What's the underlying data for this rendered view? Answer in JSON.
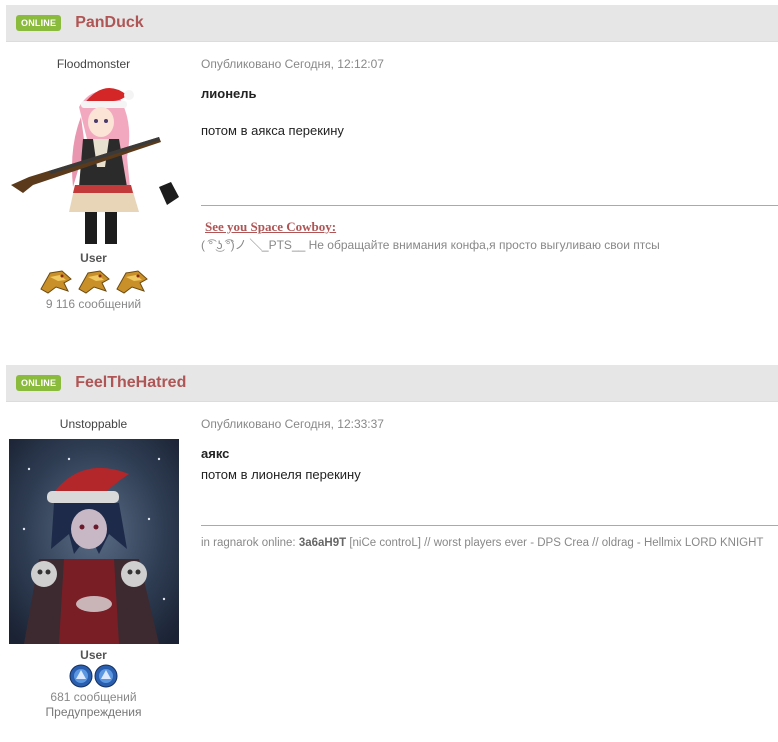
{
  "posts": [
    {
      "badge": "ONLINE",
      "username": "PanDuck",
      "user_title": "Floodmonster",
      "avatar_icon": "anime-santa-girl-rifle-avatar",
      "group": "User",
      "pips_icon": "golden-dragon-rank-icon",
      "pip_count": 3,
      "post_count": "9 116 сообщений",
      "date": "Опубликовано Сегодня, 12:12:07",
      "body_line1": "лионель",
      "body_line2": "потом в аякса перекину",
      "sig_title": "See you Space Cowboy:",
      "sig_text": "( ͡° ͜ʖ ͡°)ノ ╲_PTS__ Не обращайте внимания конфа,я просто выгуливаю свои птсы"
    },
    {
      "badge": "ONLINE",
      "username": "FeelTheHatred",
      "user_title": "Unstoppable",
      "avatar_icon": "dark-anime-santa-hat-avatar",
      "group": "User",
      "pips_icon": "blue-orb-rank-icon",
      "pip_count": 2,
      "post_count": "681 сообщений",
      "warnings": "Предупреждения",
      "date": "Опубликовано Сегодня, 12:33:37",
      "body_line1": "аякс",
      "body_line2": "потом в лионеля перекину",
      "sig_prefix": "in ragnarok online: ",
      "sig_name": "3a6aH9T",
      "sig_rest": " [niCe controL] // worst players ever - DPS Crea // oldrag - Hellmix LORD KNIGHT"
    }
  ]
}
